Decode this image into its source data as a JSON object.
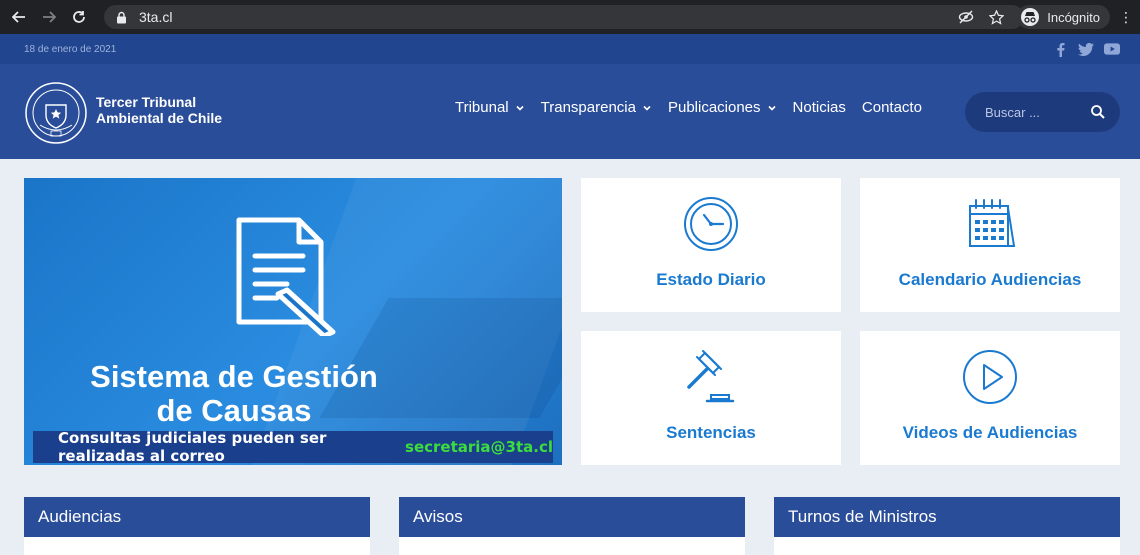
{
  "browser": {
    "url": "3ta.cl",
    "profile_label": "Incógnito"
  },
  "topbar": {
    "date": "18 de enero de 2021"
  },
  "header": {
    "brand_line1": "Tercer Tribunal",
    "brand_line2": "Ambiental de Chile",
    "menu": [
      {
        "label": "Tribunal",
        "dropdown": true
      },
      {
        "label": "Transparencia",
        "dropdown": true
      },
      {
        "label": "Publicaciones",
        "dropdown": true
      },
      {
        "label": "Noticias",
        "dropdown": false
      },
      {
        "label": "Contacto",
        "dropdown": false
      }
    ],
    "search_placeholder": "Buscar ..."
  },
  "banner": {
    "title_line1": "Sistema de Gestión",
    "title_line2": "de Causas",
    "strip_text": "Consultas judiciales pueden ser realizadas al correo",
    "strip_email": "secretaria@3ta.cl"
  },
  "tiles": [
    {
      "label": "Estado Diario",
      "icon": "clock-icon"
    },
    {
      "label": "Calendario Audiencias",
      "icon": "calendar-icon"
    },
    {
      "label": "Sentencias",
      "icon": "gavel-icon"
    },
    {
      "label": "Videos de Audiencias",
      "icon": "play-icon"
    }
  ],
  "sections": [
    {
      "title": "Audiencias"
    },
    {
      "title": "Avisos"
    },
    {
      "title": "Turnos de Ministros"
    }
  ],
  "colors": {
    "header_blue": "#2a4d9a",
    "tile_text": "#1a7ad0",
    "email_green": "#3ddc3d"
  }
}
